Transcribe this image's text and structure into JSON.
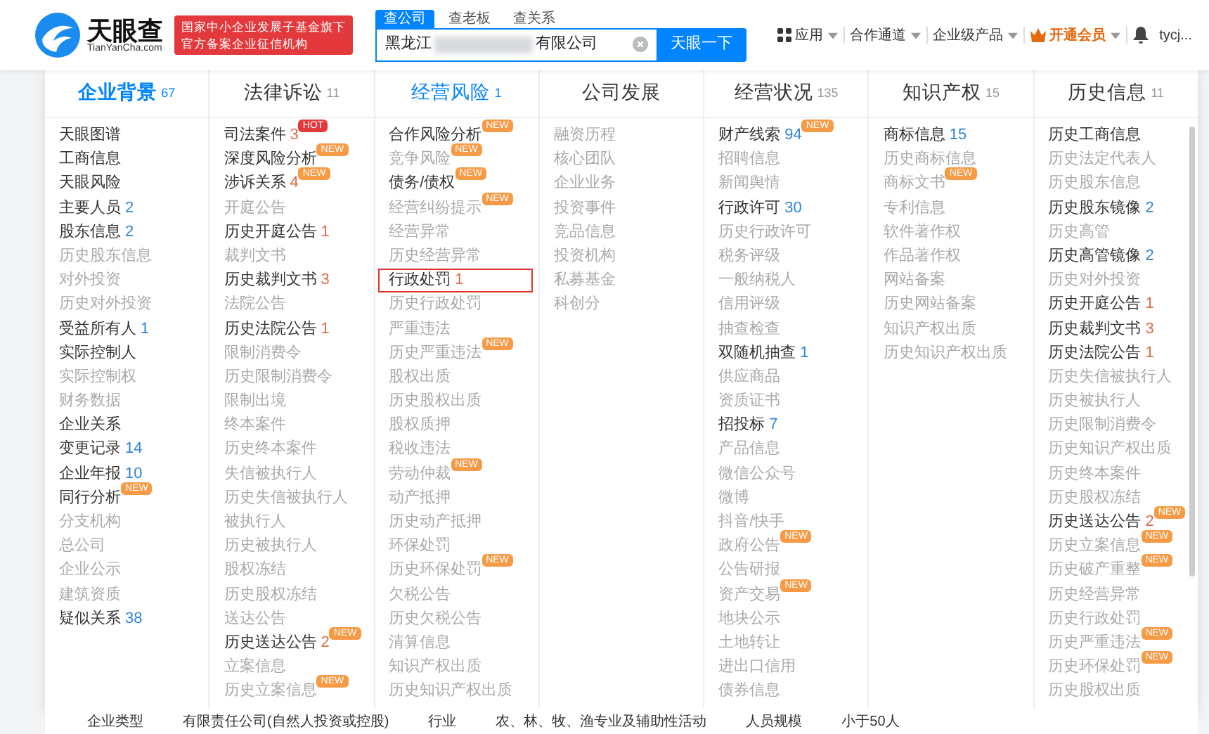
{
  "header": {
    "logo": {
      "name": "天眼查",
      "domain": "TianYanCha.com"
    },
    "banner": [
      "国家中小企业发展子基金旗下",
      "官方备案企业征信机构"
    ],
    "search_tabs": [
      {
        "label": "查公司",
        "selected": true
      },
      {
        "label": "查老板",
        "selected": false
      },
      {
        "label": "查关系",
        "selected": false
      }
    ],
    "search": {
      "value_start": "黑龙江",
      "value_end": "有限公司",
      "button": "天眼一下"
    },
    "nav": [
      {
        "kind": "apps",
        "label": "应用",
        "dropdown": true
      },
      {
        "kind": "text",
        "label": "合作通道",
        "dropdown": true
      },
      {
        "kind": "text",
        "label": "企业级产品",
        "dropdown": true
      },
      {
        "kind": "vip",
        "label": "开通会员",
        "dropdown": true
      },
      {
        "kind": "bell",
        "dropdown": false
      },
      {
        "kind": "user",
        "label": "tycj...",
        "dropdown": false
      }
    ]
  },
  "menu": [
    {
      "title": "企业背景",
      "count": "67",
      "selected": true,
      "hovered": false,
      "items": [
        {
          "label": "天眼图谱",
          "has_data": true
        },
        {
          "label": "工商信息",
          "has_data": true
        },
        {
          "label": "天眼风险",
          "has_data": true
        },
        {
          "label": "主要人员",
          "count": "2",
          "has_data": true
        },
        {
          "label": "股东信息",
          "count": "2",
          "has_data": true
        },
        {
          "label": "历史股东信息",
          "has_data": false
        },
        {
          "label": "对外投资",
          "has_data": false
        },
        {
          "label": "历史对外投资",
          "has_data": false
        },
        {
          "label": "受益所有人",
          "count": "1",
          "has_data": true
        },
        {
          "label": "实际控制人",
          "has_data": true
        },
        {
          "label": "实际控制权",
          "has_data": false
        },
        {
          "label": "财务数据",
          "has_data": false
        },
        {
          "label": "企业关系",
          "has_data": true
        },
        {
          "label": "变更记录",
          "count": "14",
          "has_data": true
        },
        {
          "label": "企业年报",
          "count": "10",
          "has_data": true
        },
        {
          "label": "同行分析",
          "has_data": true,
          "badge": {
            "text": "NEW",
            "kind": "new"
          }
        },
        {
          "label": "分支机构",
          "has_data": false
        },
        {
          "label": "总公司",
          "has_data": false
        },
        {
          "label": "企业公示",
          "has_data": false
        },
        {
          "label": "建筑资质",
          "has_data": false
        },
        {
          "label": "疑似关系",
          "count": "38",
          "has_data": true
        }
      ]
    },
    {
      "title": "法律诉讼",
      "count": "11",
      "selected": false,
      "hovered": false,
      "items": [
        {
          "label": "司法案件",
          "count": "3",
          "alert": true,
          "has_data": true,
          "badge": {
            "text": "HOT",
            "kind": "hot"
          }
        },
        {
          "label": "深度风险分析",
          "has_data": true,
          "badge": {
            "text": "NEW",
            "kind": "new"
          }
        },
        {
          "label": "涉诉关系",
          "count": "4",
          "alert": true,
          "has_data": true,
          "badge": {
            "text": "NEW",
            "kind": "new"
          }
        },
        {
          "label": "开庭公告",
          "has_data": false
        },
        {
          "label": "历史开庭公告",
          "count": "1",
          "alert": true,
          "has_data": true
        },
        {
          "label": "裁判文书",
          "has_data": false
        },
        {
          "label": "历史裁判文书",
          "count": "3",
          "alert": true,
          "has_data": true
        },
        {
          "label": "法院公告",
          "has_data": false
        },
        {
          "label": "历史法院公告",
          "count": "1",
          "alert": true,
          "has_data": true
        },
        {
          "label": "限制消费令",
          "has_data": false
        },
        {
          "label": "历史限制消费令",
          "has_data": false
        },
        {
          "label": "限制出境",
          "has_data": false
        },
        {
          "label": "终本案件",
          "has_data": false
        },
        {
          "label": "历史终本案件",
          "has_data": false
        },
        {
          "label": "失信被执行人",
          "has_data": false
        },
        {
          "label": "历史失信被执行人",
          "has_data": false
        },
        {
          "label": "被执行人",
          "has_data": false
        },
        {
          "label": "历史被执行人",
          "has_data": false
        },
        {
          "label": "股权冻结",
          "has_data": false
        },
        {
          "label": "历史股权冻结",
          "has_data": false
        },
        {
          "label": "送达公告",
          "has_data": false
        },
        {
          "label": "历史送达公告",
          "count": "2",
          "alert": true,
          "has_data": true,
          "badge": {
            "text": "NEW",
            "kind": "new"
          }
        },
        {
          "label": "立案信息",
          "has_data": false
        },
        {
          "label": "历史立案信息",
          "has_data": false,
          "badge": {
            "text": "NEW",
            "kind": "new"
          }
        }
      ]
    },
    {
      "title": "经营风险",
      "count": "1",
      "selected": false,
      "hovered": true,
      "items": [
        {
          "label": "合作风险分析",
          "has_data": true,
          "badge": {
            "text": "NEW",
            "kind": "new"
          }
        },
        {
          "label": "竞争风险",
          "has_data": false,
          "badge": {
            "text": "NEW",
            "kind": "new"
          }
        },
        {
          "label": "债务/债权",
          "has_data": true,
          "badge": {
            "text": "NEW",
            "kind": "new"
          }
        },
        {
          "label": "经营纠纷提示",
          "has_data": false,
          "badge": {
            "text": "NEW",
            "kind": "new"
          }
        },
        {
          "label": "经营异常",
          "has_data": false
        },
        {
          "label": "历史经营异常",
          "has_data": false
        },
        {
          "label": "行政处罚",
          "count": "1",
          "alert": true,
          "has_data": true,
          "highlighted": true
        },
        {
          "label": "历史行政处罚",
          "has_data": false
        },
        {
          "label": "严重违法",
          "has_data": false
        },
        {
          "label": "历史严重违法",
          "has_data": false,
          "badge": {
            "text": "NEW",
            "kind": "new"
          }
        },
        {
          "label": "股权出质",
          "has_data": false
        },
        {
          "label": "历史股权出质",
          "has_data": false
        },
        {
          "label": "股权质押",
          "has_data": false
        },
        {
          "label": "税收违法",
          "has_data": false
        },
        {
          "label": "劳动仲裁",
          "has_data": false,
          "badge": {
            "text": "NEW",
            "kind": "new"
          }
        },
        {
          "label": "动产抵押",
          "has_data": false
        },
        {
          "label": "历史动产抵押",
          "has_data": false
        },
        {
          "label": "环保处罚",
          "has_data": false
        },
        {
          "label": "历史环保处罚",
          "has_data": false,
          "badge": {
            "text": "NEW",
            "kind": "new"
          }
        },
        {
          "label": "欠税公告",
          "has_data": false
        },
        {
          "label": "历史欠税公告",
          "has_data": false
        },
        {
          "label": "清算信息",
          "has_data": false
        },
        {
          "label": "知识产权出质",
          "has_data": false
        },
        {
          "label": "历史知识产权出质",
          "has_data": false
        }
      ]
    },
    {
      "title": "公司发展",
      "selected": false,
      "hovered": false,
      "items": [
        {
          "label": "融资历程",
          "has_data": false
        },
        {
          "label": "核心团队",
          "has_data": false
        },
        {
          "label": "企业业务",
          "has_data": false
        },
        {
          "label": "投资事件",
          "has_data": false
        },
        {
          "label": "竞品信息",
          "has_data": false
        },
        {
          "label": "投资机构",
          "has_data": false
        },
        {
          "label": "私募基金",
          "has_data": false
        },
        {
          "label": "科创分",
          "has_data": false
        }
      ]
    },
    {
      "title": "经营状况",
      "count": "135",
      "selected": false,
      "hovered": false,
      "items": [
        {
          "label": "财产线索",
          "count": "94",
          "has_data": true,
          "badge": {
            "text": "NEW",
            "kind": "new"
          }
        },
        {
          "label": "招聘信息",
          "has_data": false
        },
        {
          "label": "新闻舆情",
          "has_data": false
        },
        {
          "label": "行政许可",
          "count": "30",
          "has_data": true
        },
        {
          "label": "历史行政许可",
          "has_data": false
        },
        {
          "label": "税务评级",
          "has_data": false
        },
        {
          "label": "一般纳税人",
          "has_data": false
        },
        {
          "label": "信用评级",
          "has_data": false
        },
        {
          "label": "抽查检查",
          "has_data": false
        },
        {
          "label": "双随机抽查",
          "count": "1",
          "has_data": true
        },
        {
          "label": "供应商品",
          "has_data": false
        },
        {
          "label": "资质证书",
          "has_data": false
        },
        {
          "label": "招投标",
          "count": "7",
          "has_data": true
        },
        {
          "label": "产品信息",
          "has_data": false
        },
        {
          "label": "微信公众号",
          "has_data": false
        },
        {
          "label": "微博",
          "has_data": false
        },
        {
          "label": "抖音/快手",
          "has_data": false
        },
        {
          "label": "政府公告",
          "has_data": false,
          "badge": {
            "text": "NEW",
            "kind": "new"
          }
        },
        {
          "label": "公告研报",
          "has_data": false
        },
        {
          "label": "资产交易",
          "has_data": false,
          "badge": {
            "text": "NEW",
            "kind": "new"
          }
        },
        {
          "label": "地块公示",
          "has_data": false
        },
        {
          "label": "土地转让",
          "has_data": false
        },
        {
          "label": "进出口信用",
          "has_data": false
        },
        {
          "label": "债券信息",
          "has_data": false
        }
      ]
    },
    {
      "title": "知识产权",
      "count": "15",
      "selected": false,
      "hovered": false,
      "items": [
        {
          "label": "商标信息",
          "count": "15",
          "has_data": true
        },
        {
          "label": "历史商标信息",
          "has_data": false
        },
        {
          "label": "商标文书",
          "has_data": false,
          "badge": {
            "text": "NEW",
            "kind": "new"
          }
        },
        {
          "label": "专利信息",
          "has_data": false
        },
        {
          "label": "软件著作权",
          "has_data": false
        },
        {
          "label": "作品著作权",
          "has_data": false
        },
        {
          "label": "网站备案",
          "has_data": false
        },
        {
          "label": "历史网站备案",
          "has_data": false
        },
        {
          "label": "知识产权出质",
          "has_data": false
        },
        {
          "label": "历史知识产权出质",
          "has_data": false
        }
      ]
    },
    {
      "title": "历史信息",
      "count": "11",
      "selected": false,
      "hovered": false,
      "scrollable": true,
      "items": [
        {
          "label": "历史工商信息",
          "has_data": true
        },
        {
          "label": "历史法定代表人",
          "has_data": false
        },
        {
          "label": "历史股东信息",
          "has_data": false
        },
        {
          "label": "历史股东镜像",
          "count": "2",
          "has_data": true
        },
        {
          "label": "历史高管",
          "has_data": false
        },
        {
          "label": "历史高管镜像",
          "count": "2",
          "has_data": true
        },
        {
          "label": "历史对外投资",
          "has_data": false
        },
        {
          "label": "历史开庭公告",
          "count": "1",
          "alert": true,
          "has_data": true
        },
        {
          "label": "历史裁判文书",
          "count": "3",
          "alert": true,
          "has_data": true
        },
        {
          "label": "历史法院公告",
          "count": "1",
          "alert": true,
          "has_data": true
        },
        {
          "label": "历史失信被执行人",
          "has_data": false
        },
        {
          "label": "历史被执行人",
          "has_data": false
        },
        {
          "label": "历史限制消费令",
          "has_data": false
        },
        {
          "label": "历史知识产权出质",
          "has_data": false
        },
        {
          "label": "历史终本案件",
          "has_data": false
        },
        {
          "label": "历史股权冻结",
          "has_data": false
        },
        {
          "label": "历史送达公告",
          "count": "2",
          "alert": true,
          "has_data": true,
          "badge": {
            "text": "NEW",
            "kind": "new"
          }
        },
        {
          "label": "历史立案信息",
          "has_data": false,
          "badge": {
            "text": "NEW",
            "kind": "new"
          }
        },
        {
          "label": "历史破产重整",
          "has_data": false,
          "badge": {
            "text": "NEW",
            "kind": "new"
          }
        },
        {
          "label": "历史经营异常",
          "has_data": false
        },
        {
          "label": "历史行政处罚",
          "has_data": false
        },
        {
          "label": "历史严重违法",
          "has_data": false,
          "badge": {
            "text": "NEW",
            "kind": "new"
          }
        },
        {
          "label": "历史环保处罚",
          "has_data": false,
          "badge": {
            "text": "NEW",
            "kind": "new"
          }
        },
        {
          "label": "历史股权出质",
          "has_data": false
        }
      ]
    }
  ],
  "info_strip": [
    "企业类型",
    "有限责任公司(自然人投资或控股)",
    "行业",
    "农、林、牧、渔专业及辅助性活动",
    "人员规模",
    "小于50人"
  ]
}
